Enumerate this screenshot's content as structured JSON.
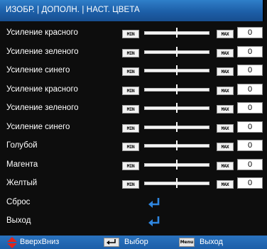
{
  "header": {
    "title": "ИЗОБР. | ДОПОЛН. | НАСТ. ЦВЕТА"
  },
  "slider_rows": [
    {
      "label": "Усиление красного",
      "min_label": "MIN",
      "max_label": "MAX",
      "value": "0",
      "level": 0.5
    },
    {
      "label": "Усиление зеленого",
      "min_label": "MIN",
      "max_label": "MAX",
      "value": "0",
      "level": 0.5
    },
    {
      "label": "Усиление синего",
      "min_label": "MIN",
      "max_label": "MAX",
      "value": "0",
      "level": 0.5
    },
    {
      "label": "Усиление красного",
      "min_label": "MIN",
      "max_label": "MAX",
      "value": "0",
      "level": 0.5
    },
    {
      "label": "Усиление зеленого",
      "min_label": "MIN",
      "max_label": "MAX",
      "value": "0",
      "level": 0.5
    },
    {
      "label": "Усиление синего",
      "min_label": "MIN",
      "max_label": "MAX",
      "value": "0",
      "level": 0.5
    },
    {
      "label": "Голубой",
      "min_label": "MIN",
      "max_label": "MAX",
      "value": "0",
      "level": 0.5
    },
    {
      "label": "Магента",
      "min_label": "MIN",
      "max_label": "MAX",
      "value": "0",
      "level": 0.5
    },
    {
      "label": "Желтый",
      "min_label": "MIN",
      "max_label": "MAX",
      "value": "0",
      "level": 0.5
    }
  ],
  "action_rows": [
    {
      "label": "Сброс",
      "icon": "enter-arrow-icon"
    },
    {
      "label": "Выход",
      "icon": "enter-arrow-icon"
    }
  ],
  "footer": {
    "updown_label": "ВверхВниз",
    "select_label": "Выбор",
    "menu_key": "Menu",
    "exit_label": "Выход"
  },
  "colors": {
    "header_blue": "#1d5fa8",
    "footer_blue": "#1c5ea8",
    "enter_arrow": "#2f86e0",
    "updown_arrow": "#e0251c",
    "background": "#0d0d0d"
  }
}
